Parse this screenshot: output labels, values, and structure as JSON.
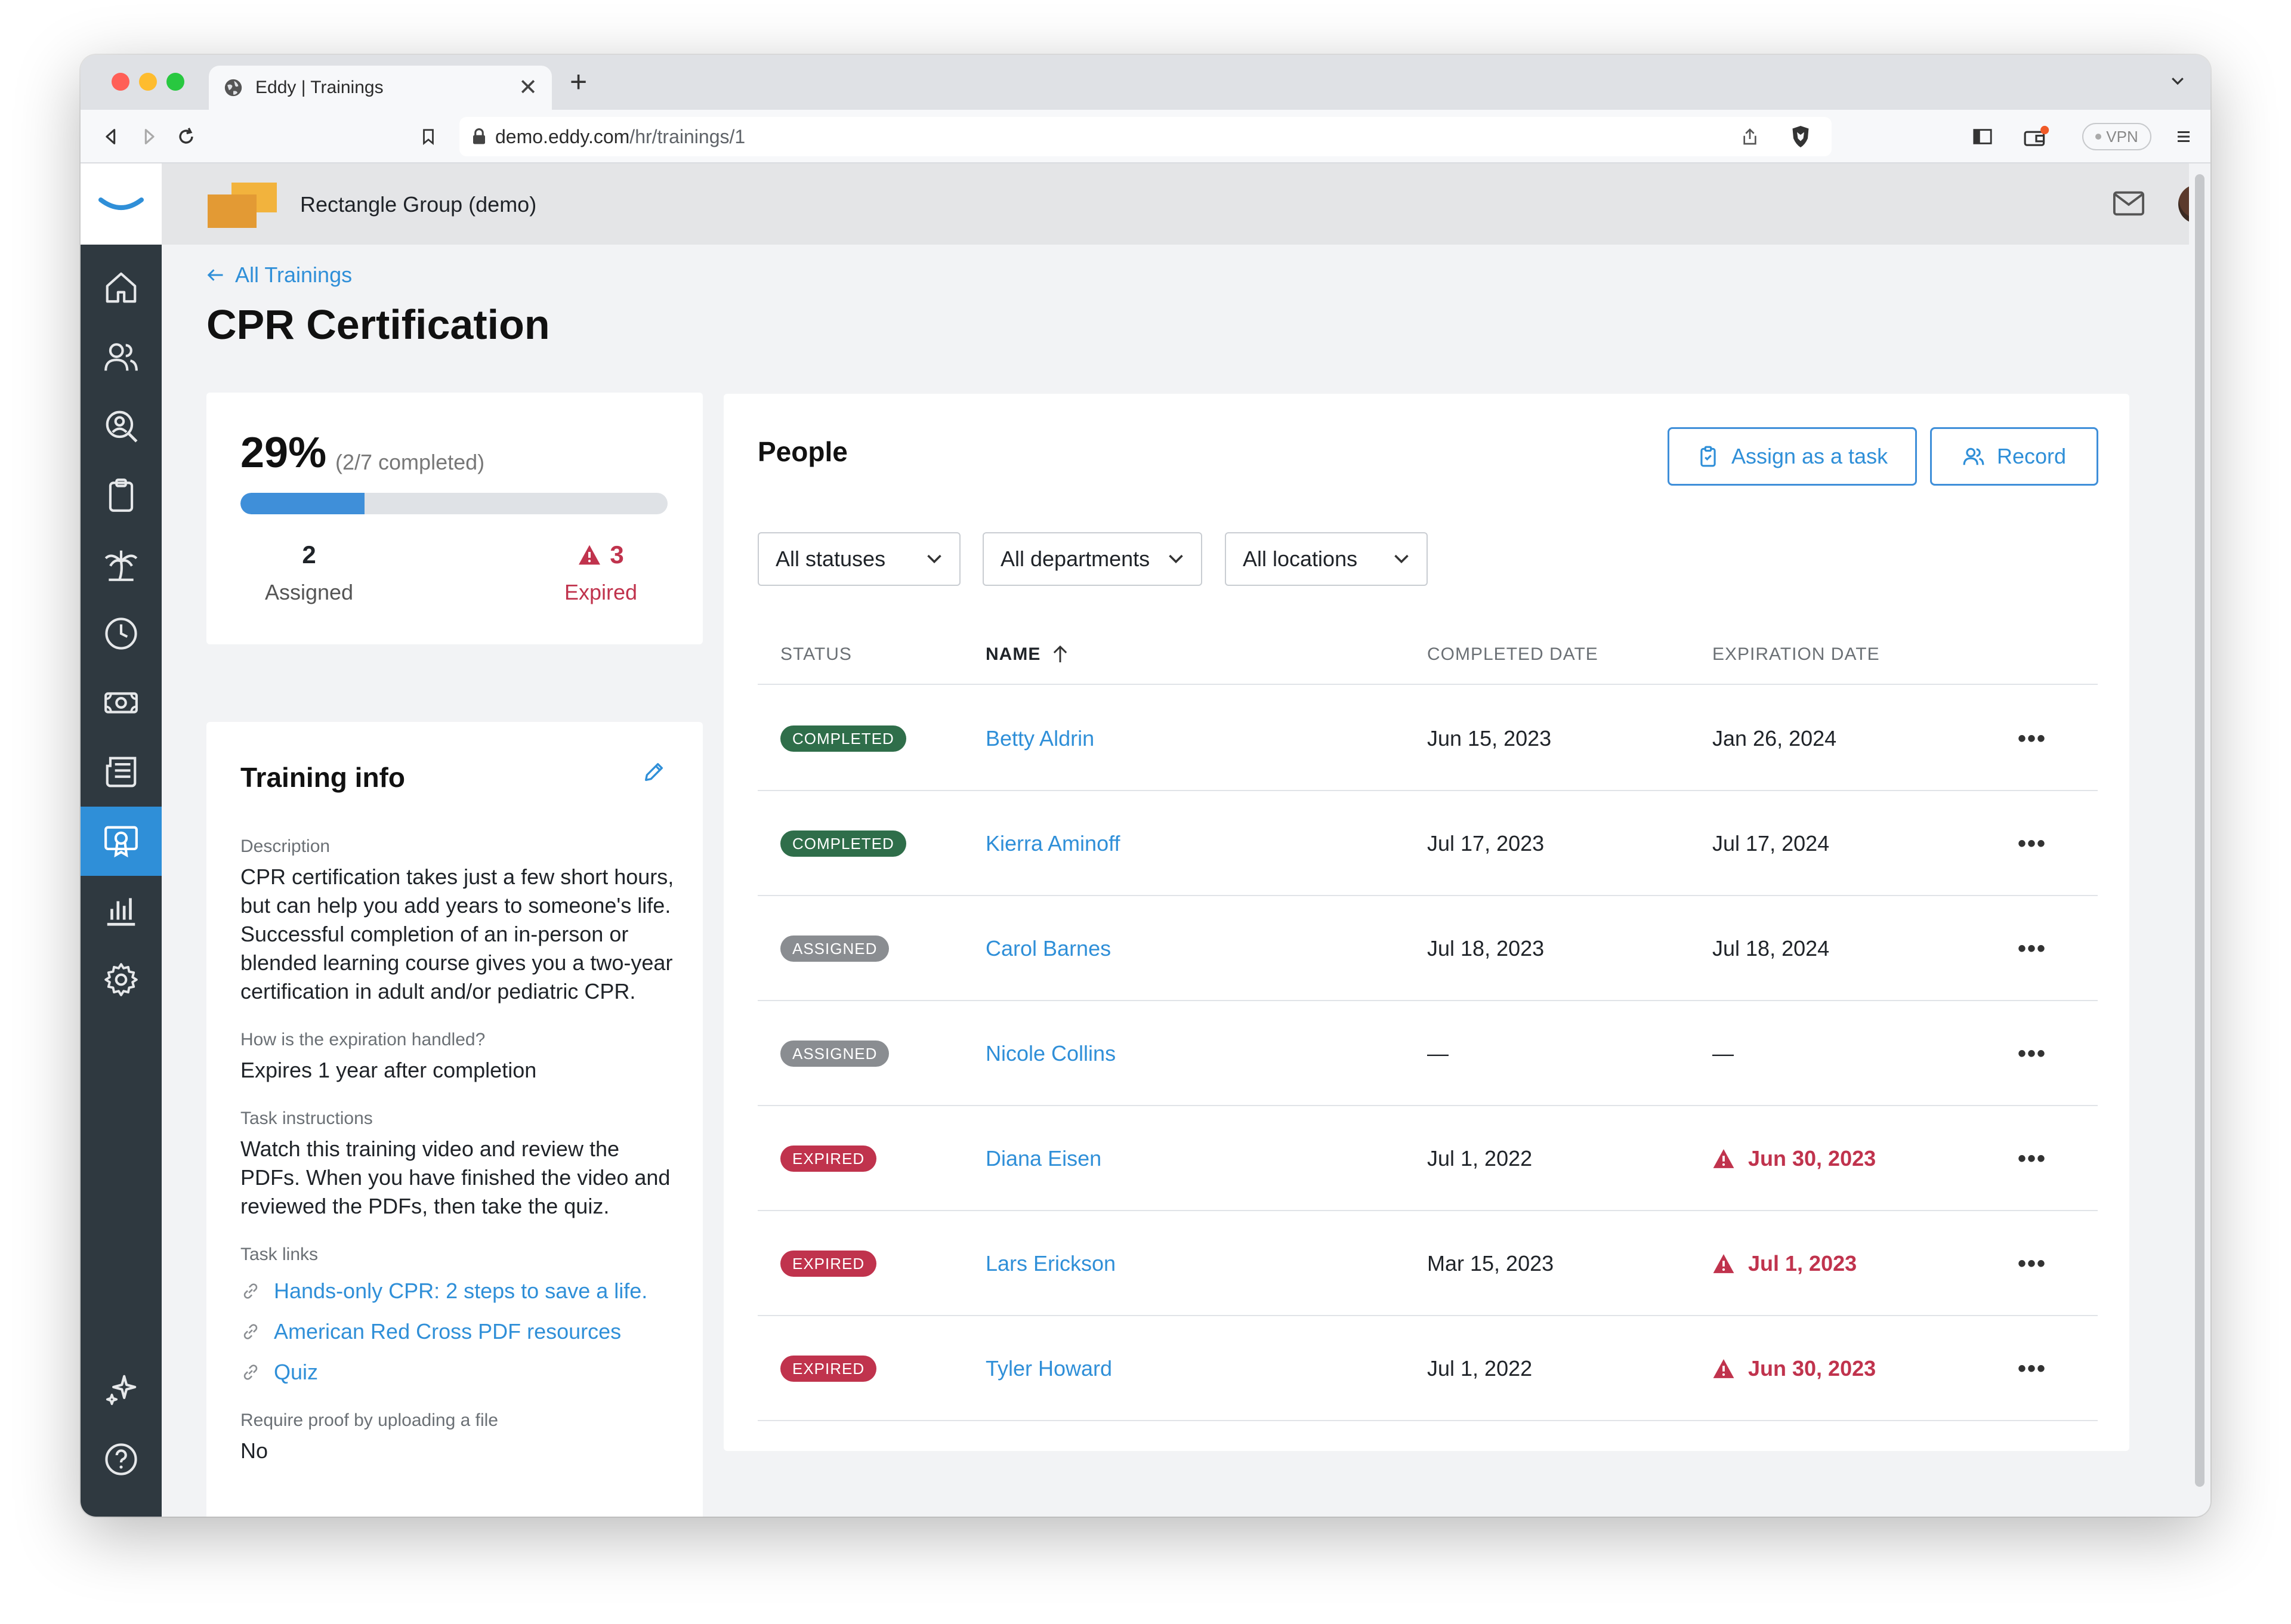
{
  "browser": {
    "tab_title": "Eddy | Trainings",
    "tab_close": "✕",
    "new_tab": "+",
    "url_host": "demo.eddy.com",
    "url_path": "/hr/trainings/1",
    "vpn_label": "VPN"
  },
  "header": {
    "org_name": "Rectangle Group (demo)"
  },
  "sidebar": {
    "items": [
      {
        "icon": "home-icon"
      },
      {
        "icon": "people-icon"
      },
      {
        "icon": "search-person-icon"
      },
      {
        "icon": "clipboard-icon"
      },
      {
        "icon": "palm-tree-icon"
      },
      {
        "icon": "clock-icon"
      },
      {
        "icon": "money-icon"
      },
      {
        "icon": "newspaper-icon"
      },
      {
        "icon": "training-certificate-icon",
        "active": true
      },
      {
        "icon": "bar-chart-icon"
      },
      {
        "icon": "gear-icon"
      },
      {
        "icon": "sparkle-icon"
      },
      {
        "icon": "help-icon"
      }
    ]
  },
  "page": {
    "back_label": "All Trainings",
    "title": "CPR Certification"
  },
  "progress": {
    "percent_label": "29%",
    "completed_label": "(2/7 completed)",
    "fraction": 0.29,
    "assigned_count": "2",
    "assigned_label": "Assigned",
    "expired_count": "3",
    "expired_label": "Expired"
  },
  "training_info": {
    "title": "Training info",
    "description_label": "Description",
    "description": "CPR certification takes just a few short hours, but can help you add years to someone's life. Successful completion of an in-person or blended learning course gives you a two-year certification in adult and/or pediatric CPR.",
    "expiration_label": "How is the expiration handled?",
    "expiration_value": "Expires 1 year after completion",
    "instructions_label": "Task instructions",
    "instructions": "Watch this training video and review the PDFs. When you have finished the video and reviewed the PDFs, then take the quiz.",
    "links_label": "Task links",
    "links": [
      "Hands-only CPR: 2 steps to save a life.",
      "American Red Cross PDF resources",
      "Quiz"
    ],
    "proof_label": "Require proof by uploading a file",
    "proof_value": "No"
  },
  "people": {
    "title": "People",
    "assign_button": "Assign as a task",
    "record_button": "Record",
    "filters": {
      "status": "All statuses",
      "departments": "All departments",
      "locations": "All locations"
    },
    "columns": {
      "status": "STATUS",
      "name": "NAME",
      "completed": "COMPLETED DATE",
      "expiration": "EXPIRATION DATE"
    },
    "more_label": "•••",
    "rows": [
      {
        "status": "COMPLETED",
        "status_kind": "completed",
        "name": "Betty Aldrin",
        "completed": "Jun 15, 2023",
        "expiration": "Jan 26, 2024",
        "expired": false
      },
      {
        "status": "COMPLETED",
        "status_kind": "completed",
        "name": "Kierra Aminoff",
        "completed": "Jul 17, 2023",
        "expiration": "Jul 17, 2024",
        "expired": false
      },
      {
        "status": "ASSIGNED",
        "status_kind": "assigned",
        "name": "Carol Barnes",
        "completed": "Jul 18, 2023",
        "expiration": "Jul 18, 2024",
        "expired": false
      },
      {
        "status": "ASSIGNED",
        "status_kind": "assigned",
        "name": "Nicole Collins",
        "completed": "—",
        "expiration": "—",
        "expired": false
      },
      {
        "status": "EXPIRED",
        "status_kind": "expired",
        "name": "Diana Eisen",
        "completed": "Jul 1, 2022",
        "expiration": "Jun 30, 2023",
        "expired": true
      },
      {
        "status": "EXPIRED",
        "status_kind": "expired",
        "name": "Lars Erickson",
        "completed": "Mar 15, 2023",
        "expiration": "Jul 1, 2023",
        "expired": true
      },
      {
        "status": "EXPIRED",
        "status_kind": "expired",
        "name": "Tyler Howard",
        "completed": "Jul 1, 2022",
        "expiration": "Jun 30, 2023",
        "expired": true
      }
    ]
  },
  "colors": {
    "accent": "#2f8fd8",
    "sidebar": "#2f3940",
    "completed": "#2f6e4a",
    "assigned": "#8a8d91",
    "expired": "#c0334d"
  }
}
